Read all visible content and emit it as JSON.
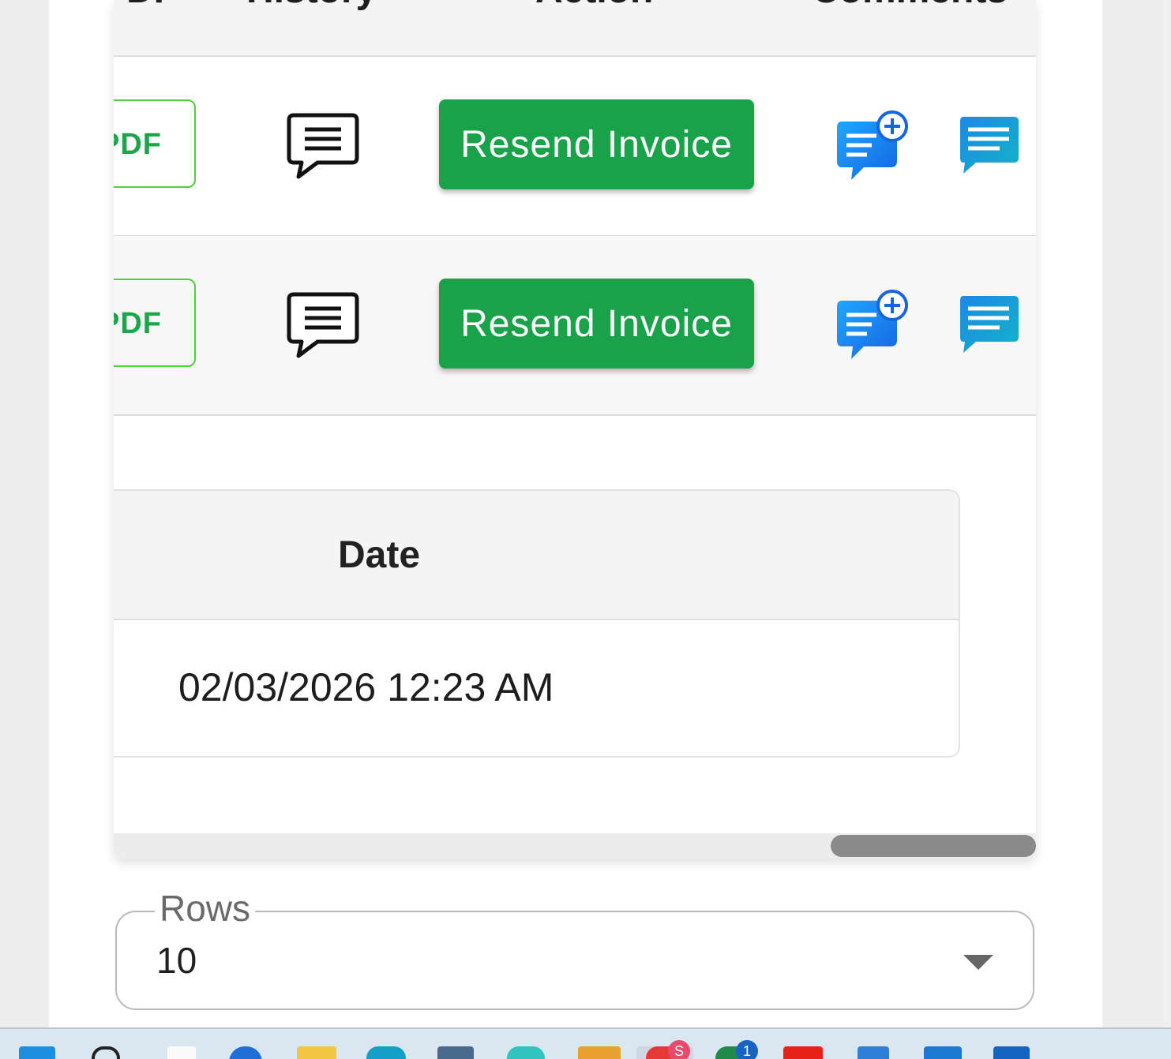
{
  "table": {
    "headers": [
      "DF",
      "History",
      "Action",
      "Comments"
    ],
    "rows": [
      {
        "pdf_label": "PDF",
        "action_label": "Resend Invoice"
      },
      {
        "pdf_label": "PDF",
        "action_label": "Resend Invoice"
      }
    ],
    "detail": {
      "header": "Date",
      "value": "02/03/2026 12:23 AM"
    }
  },
  "pagination": {
    "rows_label": "Rows",
    "rows_value": "10"
  },
  "taskbar": {
    "apps": [
      "start-icon",
      "search-icon",
      "file-icon",
      "azure-icon",
      "file-explorer-icon",
      "edge-icon",
      "toolbox-icon",
      "wave-app-icon",
      "favorites-icon",
      "chrome-icon",
      "teams-icon",
      "youtube-icon",
      "calendar-icon",
      "vscode-icon",
      "profile-icon"
    ],
    "badges": {
      "chrome": "S",
      "teams": "1"
    }
  },
  "colors": {
    "action_green": "#1aa24a",
    "pdf_border": "#4cd137",
    "pdf_text": "#1aa74a",
    "comment_blue": "#1e88e5"
  }
}
